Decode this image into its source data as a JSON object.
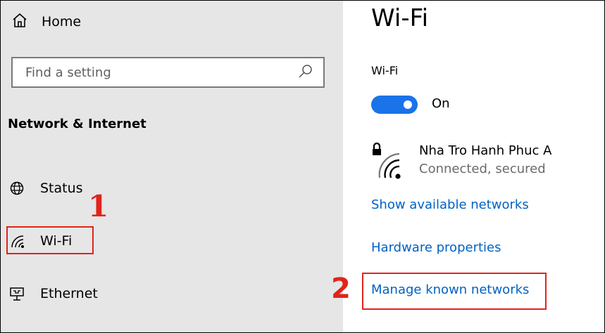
{
  "sidebar": {
    "home_label": "Home",
    "search_placeholder": "Find a setting",
    "section_title": "Network & Internet",
    "items": [
      {
        "label": "Status",
        "icon": "globe-icon"
      },
      {
        "label": "Wi-Fi",
        "icon": "wifi-icon"
      },
      {
        "label": "Ethernet",
        "icon": "ethernet-icon"
      }
    ]
  },
  "main": {
    "title": "Wi-Fi",
    "wifi_label": "Wi-Fi",
    "toggle_state": "On",
    "network": {
      "name": "Nha Tro Hanh Phuc A",
      "status": "Connected, secured"
    },
    "links": {
      "show_networks": "Show available networks",
      "hardware_properties": "Hardware properties",
      "manage_networks": "Manage known networks"
    }
  },
  "annotations": {
    "marker_1": "1",
    "marker_2": "2"
  },
  "colors": {
    "accent": "#1a73e8",
    "link": "#0062c4",
    "highlight": "#e0241b",
    "sidebar_bg": "#e6e6e6"
  }
}
